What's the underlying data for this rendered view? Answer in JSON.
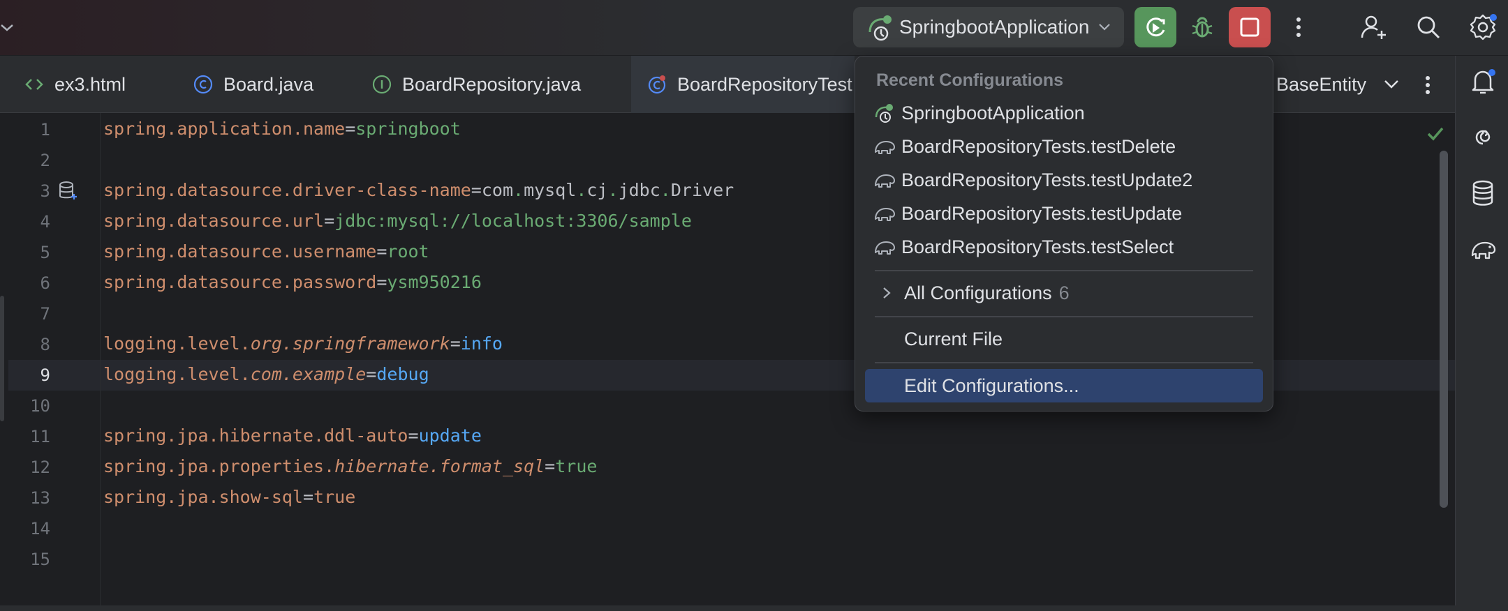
{
  "run_toolbar": {
    "config_name": "SpringbootApplication",
    "rerun_icon": "rerun-icon",
    "debug_icon": "bug-icon",
    "stop_icon": "stop-icon",
    "more_icon": "more-vertical-icon",
    "user_icon": "add-user-icon",
    "search_icon": "search-icon",
    "settings_icon": "gear-icon"
  },
  "tabs": [
    {
      "label": "ex3.html",
      "icon": "html-icon"
    },
    {
      "label": "Board.java",
      "icon": "class-icon"
    },
    {
      "label": "BoardRepository.java",
      "icon": "interface-icon"
    },
    {
      "label": "BoardRepositoryTest",
      "icon": "test-class-icon",
      "active": true
    },
    {
      "label": "BaseEntity",
      "icon": "class-icon"
    }
  ],
  "editor": {
    "line_numbers": [
      "1",
      "2",
      "3",
      "4",
      "5",
      "6",
      "7",
      "8",
      "9",
      "10",
      "11",
      "12",
      "13",
      "14",
      "15"
    ],
    "current_line": "9",
    "lines": [
      {
        "key": "spring.application.name",
        "value": "springboot"
      },
      {
        "key": "spring.datasource.driver-class-name",
        "value": "com.mysql.cj.jdbc.Driver"
      },
      {
        "key": "spring.datasource.url",
        "value": "jdbc:mysql://localhost:3306/sample"
      },
      {
        "key": "spring.datasource.username",
        "value": "root"
      },
      {
        "key": "spring.datasource.password",
        "value": "ysm950216"
      },
      {
        "key_plain": "logging.level.",
        "key_italic": "org.springframework",
        "value": "info"
      },
      {
        "key_plain": "logging.level.",
        "key_italic": "com.example",
        "value": "debug"
      },
      {
        "key": "spring.jpa.hibernate.ddl-auto",
        "value": "update"
      },
      {
        "key_plain": "spring.jpa.properties.",
        "key_italic": "hibernate.format_sql",
        "value": "true"
      },
      {
        "key": "spring.jpa.show-sql",
        "value": "true"
      }
    ],
    "driver_parts": {
      "com": "com",
      "mysql": "mysql",
      "cj": "cj",
      "jdbc": "jdbc",
      "Driver": "Driver"
    },
    "eq": "="
  },
  "popup": {
    "header": "Recent Configurations",
    "recent": [
      {
        "label": "SpringbootApplication",
        "icon": "spring-boot-icon"
      },
      {
        "label": "BoardRepositoryTests.testDelete",
        "icon": "junit-test-icon"
      },
      {
        "label": "BoardRepositoryTests.testUpdate2",
        "icon": "junit-test-icon"
      },
      {
        "label": "BoardRepositoryTests.testUpdate",
        "icon": "junit-test-icon"
      },
      {
        "label": "BoardRepositoryTests.testSelect",
        "icon": "junit-test-icon"
      }
    ],
    "all_configurations": {
      "label": "All Configurations",
      "count": "6"
    },
    "current_file": "Current File",
    "edit_configurations": "Edit Configurations..."
  },
  "colors": {
    "background": "#1e1f22",
    "panel": "#2b2d30",
    "key": "#cf8e6d",
    "string_value": "#6aab73",
    "keyword_value": "#56a8f5",
    "selection": "#2e436e",
    "run_green": "#57965c",
    "stop_red": "#c94f4f"
  }
}
